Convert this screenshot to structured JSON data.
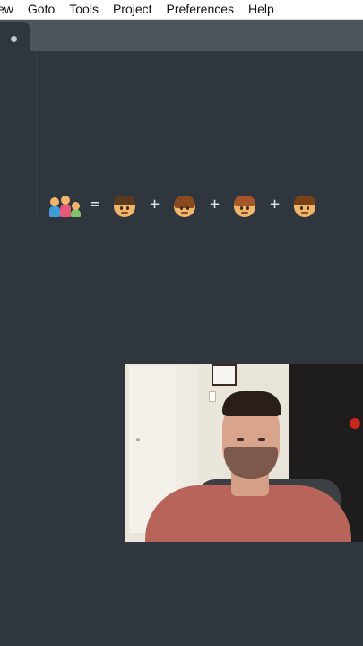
{
  "menubar": {
    "items": [
      "ew",
      "Goto",
      "Tools",
      "Project",
      "Preferences",
      "Help"
    ]
  },
  "editor": {
    "line_operators": [
      "=",
      "+",
      "+",
      "+"
    ],
    "emoji_names": [
      "family-icon",
      "boy-icon",
      "woman-icon",
      "girl-icon",
      "man-icon"
    ]
  },
  "colors": {
    "editor_bg": "#2f363d",
    "tabstrip_bg": "#4d555d",
    "menubar_bg": "#ffffff"
  }
}
